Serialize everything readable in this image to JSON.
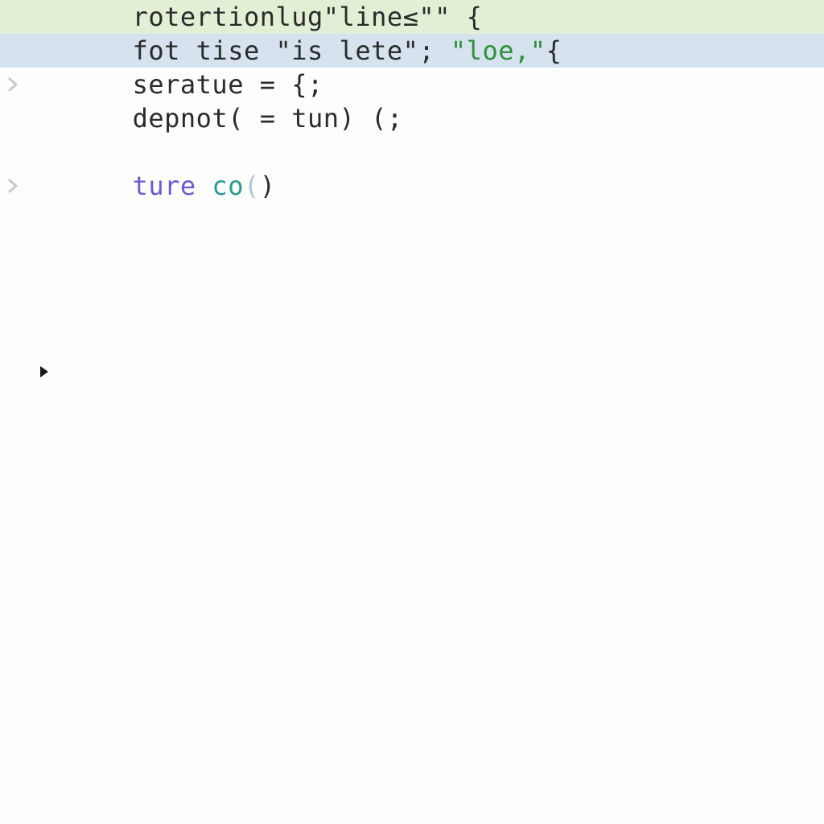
{
  "lines": {
    "l1": {
      "bg": "green",
      "segments": {
        "a": "rotertionlug\"line",
        "b": "≤",
        "c": "\"\" {"
      }
    },
    "l2": {
      "bg": "blue",
      "segments": {
        "a": "fot tise ",
        "b": "\"is lete\"",
        "c": "; ",
        "d": "\"loe,\"",
        "e": "{"
      }
    },
    "l3": {
      "gutter": "chevron",
      "segments": {
        "a": "seratue = {;"
      }
    },
    "l4": {
      "segments": {
        "a": "depnot( = tun) (;"
      }
    },
    "l5": {
      "segments": {
        "a": ""
      }
    },
    "l6": {
      "gutter": "chevron",
      "segments": {
        "a": "ture",
        "b": " ",
        "c": "co",
        "d": "(",
        "e": ")"
      }
    }
  },
  "caret_icon": "triangle-right"
}
